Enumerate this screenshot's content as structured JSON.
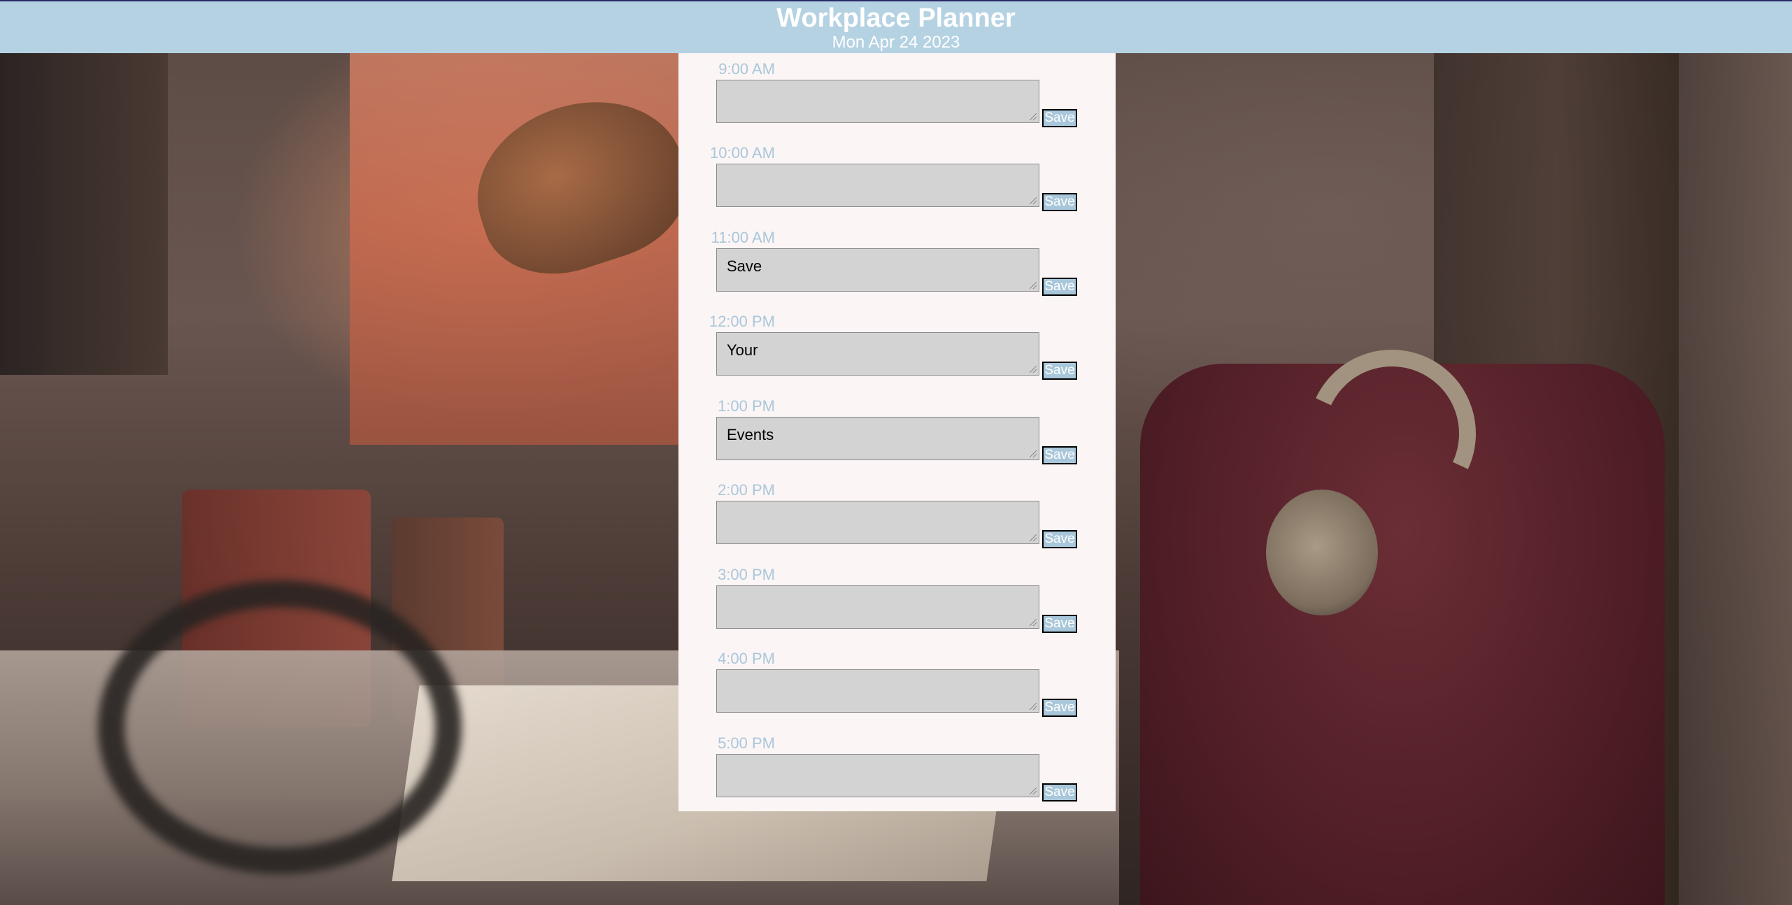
{
  "header": {
    "title": "Workplace Planner",
    "date": "Mon Apr 24 2023"
  },
  "slots": [
    {
      "time": "9:00 AM",
      "text": "",
      "save_label": "Save"
    },
    {
      "time": "10:00 AM",
      "text": "",
      "save_label": "Save"
    },
    {
      "time": "11:00 AM",
      "text": "Save",
      "save_label": "Save"
    },
    {
      "time": "12:00 PM",
      "text": "Your",
      "save_label": "Save"
    },
    {
      "time": "1:00 PM",
      "text": "Events",
      "save_label": "Save"
    },
    {
      "time": "2:00 PM",
      "text": "",
      "save_label": "Save"
    },
    {
      "time": "3:00 PM",
      "text": "",
      "save_label": "Save"
    },
    {
      "time": "4:00 PM",
      "text": "",
      "save_label": "Save"
    },
    {
      "time": "5:00 PM",
      "text": "",
      "save_label": "Save"
    }
  ],
  "colors": {
    "header_bg": "#b5d2e3",
    "accent": "#a9c7da",
    "panel_bg": "#fcf5f5",
    "textarea_bg": "#d3d3d3"
  }
}
